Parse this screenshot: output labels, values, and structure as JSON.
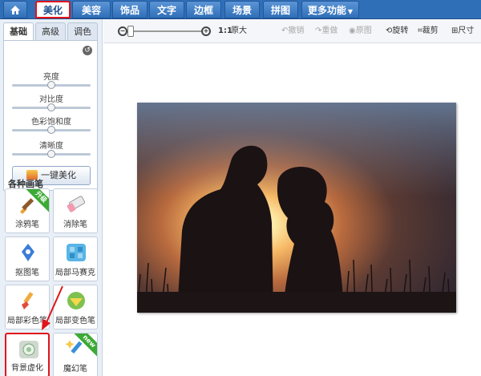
{
  "nav": {
    "home_icon": "home-icon",
    "tabs": [
      {
        "label": "美化",
        "active": true
      },
      {
        "label": "美容",
        "active": false
      },
      {
        "label": "饰品",
        "active": false
      },
      {
        "label": "文字",
        "active": false
      },
      {
        "label": "边框",
        "active": false
      },
      {
        "label": "场景",
        "active": false
      },
      {
        "label": "拼图",
        "active": false
      },
      {
        "label": "更多功能",
        "active": false
      }
    ]
  },
  "left_panel": {
    "subtabs": [
      "基础",
      "高级",
      "调色"
    ],
    "active_subtab": "基础",
    "sliders": [
      {
        "label": "亮度",
        "value": 0.5
      },
      {
        "label": "对比度",
        "value": 0.5
      },
      {
        "label": "色彩饱和度",
        "value": 0.5
      },
      {
        "label": "清晰度",
        "value": 0.5
      }
    ],
    "one_click_button": "一键美化",
    "section_title": "各种画笔",
    "brushes": [
      {
        "label": "涂鸦笔",
        "badge": "升级"
      },
      {
        "label": "消除笔",
        "badge": ""
      },
      {
        "label": "抠图笔",
        "badge": ""
      },
      {
        "label": "局部马赛克",
        "badge": ""
      },
      {
        "label": "局部彩色笔",
        "badge": ""
      },
      {
        "label": "局部变色笔",
        "badge": ""
      },
      {
        "label": "背景虚化",
        "badge": ""
      },
      {
        "label": "魔幻笔",
        "badge": "new"
      }
    ]
  },
  "toolbar": {
    "zoom_ratio": "1:1",
    "original_size": "原大",
    "undo": "撤销",
    "redo": "重做",
    "original_image": "原图",
    "rotate": "旋转",
    "crop": "裁剪",
    "resize": "尺寸"
  },
  "colors": {
    "nav_blue": "#2f6fb8",
    "highlight_red": "#e0141c",
    "badge_green": "#3caa35"
  }
}
